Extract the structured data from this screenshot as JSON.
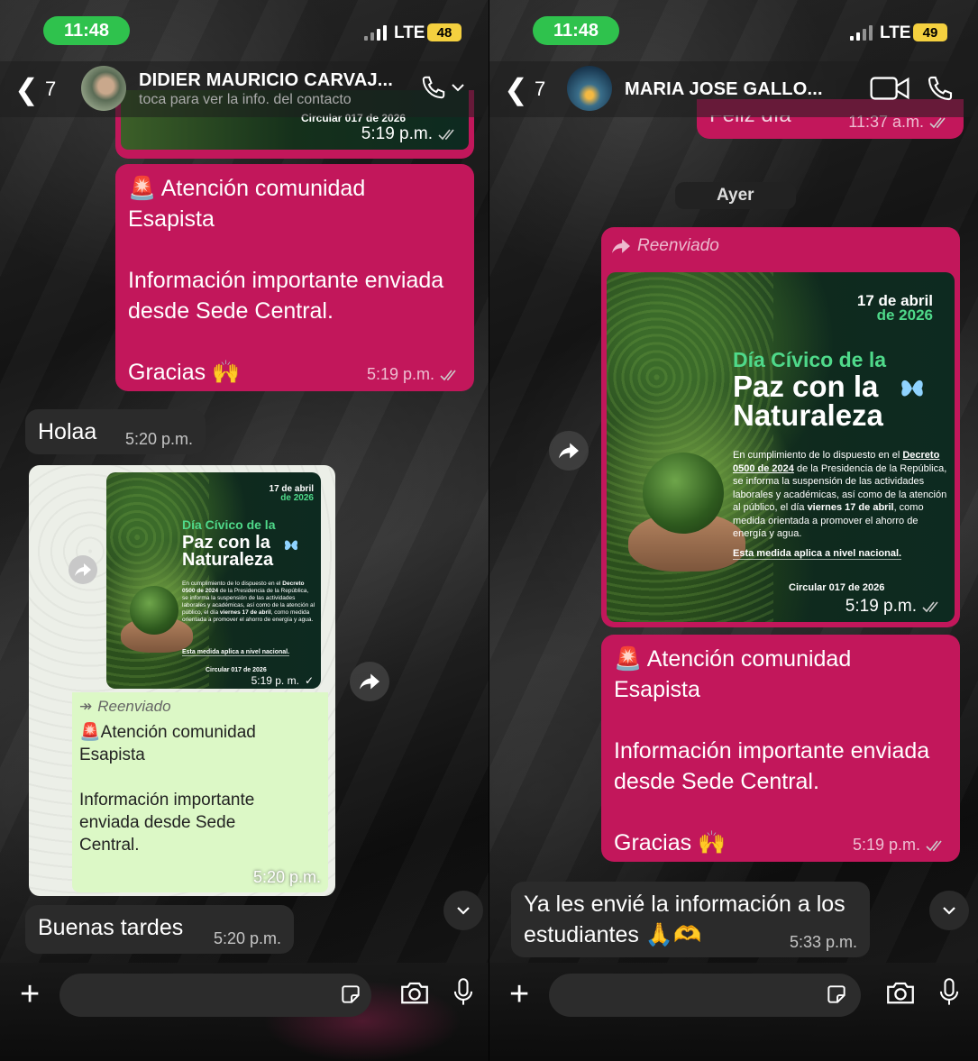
{
  "left": {
    "status": {
      "time": "11:48",
      "network": "LTE",
      "battery": "48"
    },
    "header": {
      "back_count": "7",
      "contact_name": "DIDIER MAURICIO CARVAJ...",
      "contact_sub": "toca para ver la info. del contacto"
    },
    "top_partial": {
      "caption": "Circular 017 de 2026",
      "time": "5:19 p.m."
    },
    "announcement": {
      "text": "🚨 Atención comunidad\nEsapista\n\nInformación importante enviada\ndesde Sede Central.\n\nGracias 🙌",
      "time": "5:19 p.m."
    },
    "holaa": {
      "text": "Holaa",
      "time": "5:20 p.m."
    },
    "forwarded_card": {
      "poster_time": "5:19 p. m.",
      "forwarded_label": "Reenviado",
      "text": "🚨Atención comunidad\nEsapista\n\nInformación importante\nenviada desde Sede\nCentral.",
      "time": "5:20 p.m."
    },
    "buenas": {
      "text": "Buenas tardes",
      "time": "5:20 p.m."
    }
  },
  "right": {
    "status": {
      "time": "11:48",
      "network": "LTE",
      "battery": "49"
    },
    "header": {
      "back_count": "7",
      "contact_name": "MARIA JOSE GALLO..."
    },
    "top_partial": {
      "text": "Feliz día",
      "time": "11:37 a.m."
    },
    "date_divider": "Ayer",
    "forwarded": {
      "label": "Reenviado",
      "time": "5:19 p.m."
    },
    "announcement": {
      "text": "🚨 Atención comunidad\nEsapista\n\nInformación importante enviada\ndesde Sede Central.\n\nGracias 🙌",
      "time": "5:19 p.m."
    },
    "reply": {
      "text": "Ya les envié la información a los\nestudiantes 🙏🫶",
      "time": "5:33 p.m."
    }
  },
  "poster": {
    "date_line1": "17 de abril",
    "date_line2": "de 2026",
    "title_line1": "Día Cívico de la",
    "title_line2": "Paz con la",
    "title_line3": "Naturaleza",
    "body_1": "En cumplimiento de lo dispuesto en el",
    "body_decree": "Decreto 0500 de 2024",
    "body_2": " de la Presidencia de la República, se informa la suspensión de las actividades laborales y académicas, así como de la atención al público, el día ",
    "body_day": "viernes 17 de abril",
    "body_3": ", como medida orientada a promover el ahorro de energía y agua.",
    "note": "Esta medida aplica a nivel nacional.",
    "circular": "Circular 017 de 2026"
  },
  "colors": {
    "bubble_pink": "#c2175b",
    "status_green": "#2fc24d",
    "bubble_light": "#dcf8c6"
  }
}
